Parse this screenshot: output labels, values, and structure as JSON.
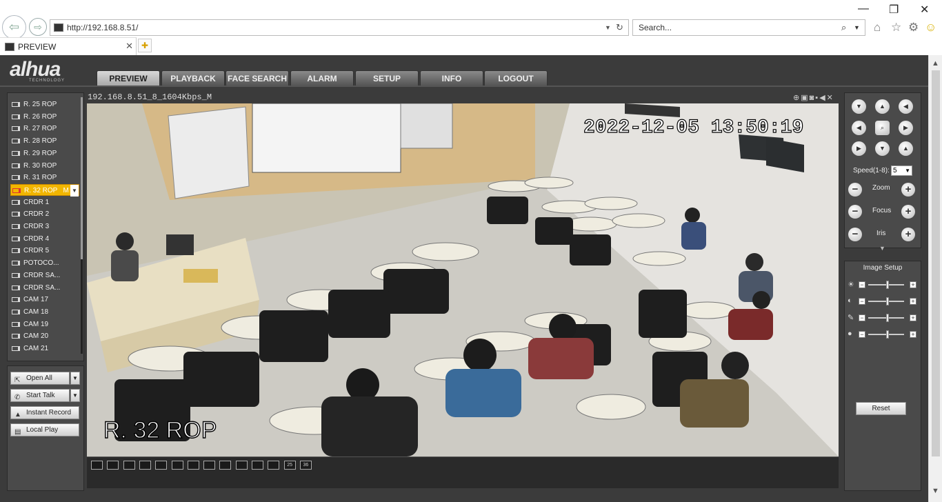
{
  "browser": {
    "url": "http://192.168.8.51/",
    "search_placeholder": "Search...",
    "tab_title": "PREVIEW"
  },
  "app": {
    "logo": "alhua",
    "logo_sub": "TECHNOLOGY",
    "nav": [
      "PREVIEW",
      "PLAYBACK",
      "FACE SEARCH",
      "ALARM",
      "SETUP",
      "INFO",
      "LOGOUT"
    ],
    "active_nav": "PREVIEW"
  },
  "channels": [
    "R. 25 ROP",
    "R. 26 ROP",
    "R. 27 ROP",
    "R. 28 ROP",
    "R. 29 ROP",
    "R. 30 ROP",
    "R. 31 ROP",
    "R. 32 ROP   M",
    "CRDR 1",
    "CRDR 2",
    "CRDR 3",
    "CRDR 4",
    "CRDR 5",
    "POTOCO...",
    "CRDR SA...",
    "CRDR SA...",
    "CAM 17",
    "CAM 18",
    "CAM 19",
    "CAM 20",
    "CAM 21"
  ],
  "selected_channel_index": 7,
  "actions": {
    "open_all": "Open All",
    "start_talk": "Start Talk",
    "instant_record": "Instant Record",
    "local_play": "Local Play"
  },
  "video": {
    "title": "192.168.8.51_8_1604Kbps_M",
    "timestamp": "2022-12-05 13:50:19",
    "channel_overlay": "R. 32 ROP"
  },
  "layouts": [
    "",
    "",
    "",
    "",
    "",
    "",
    "",
    "",
    "",
    "",
    "",
    "",
    "25",
    "36"
  ],
  "ptz": {
    "speed_label": "Speed(1-8):",
    "speed_value": "5",
    "zoom": "Zoom",
    "focus": "Focus",
    "iris": "Iris"
  },
  "image_setup": {
    "title": "Image Setup",
    "reset": "Reset"
  }
}
